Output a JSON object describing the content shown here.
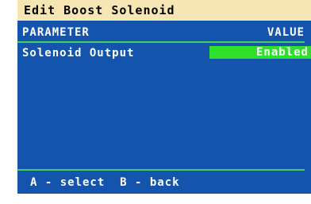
{
  "title": "Edit Boost Solenoid",
  "header": {
    "parameter_label": "PARAMETER",
    "value_label": "VALUE"
  },
  "parameters": [
    {
      "name": "Solenoid Output",
      "value": "Enabled"
    }
  ],
  "footer": {
    "hint": "A - select  B - back"
  },
  "colors": {
    "title_background": "#f6e6b4",
    "panel_background": "#1454ad",
    "rule": "#43d05c",
    "selected_value_background": "#2fe02a",
    "text": "#ffffff"
  }
}
